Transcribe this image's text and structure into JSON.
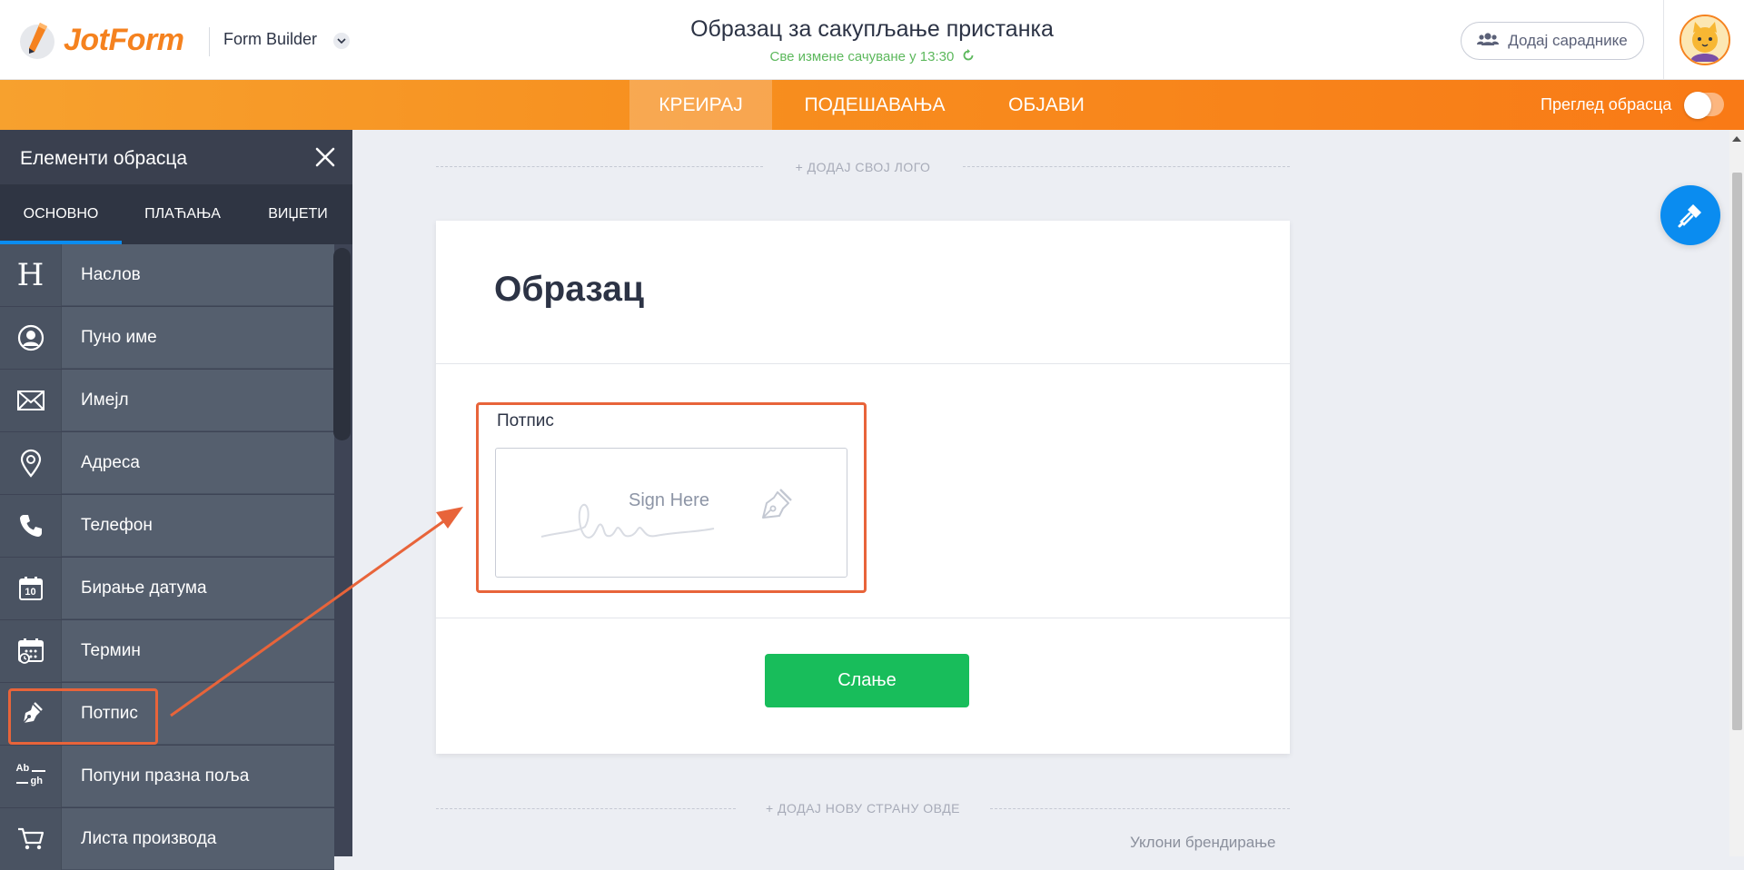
{
  "header": {
    "brand": "JotForm",
    "builder_label": "Form Builder",
    "form_title": "Образац за сакупљање пристанка",
    "save_status": "Све измене сачуване у 13:30",
    "collab_button": "Додај сараднике"
  },
  "nav": {
    "tabs": [
      {
        "label": "КРЕИРАЈ",
        "active": true
      },
      {
        "label": "ПОДЕШАВАЊА",
        "active": false
      },
      {
        "label": "ОБЈАВИ",
        "active": false
      }
    ],
    "preview_label": "Преглед обрасца"
  },
  "panel": {
    "title": "Елементи обрасца",
    "tabs": [
      {
        "label": "ОСНОВНО",
        "active": true
      },
      {
        "label": "ПЛАЋАЊА",
        "active": false
      },
      {
        "label": "ВИЏЕТИ",
        "active": false
      }
    ],
    "elements": [
      {
        "label": "Наслов",
        "icon": "heading-icon"
      },
      {
        "label": "Пуно име",
        "icon": "user-circle-icon"
      },
      {
        "label": "Имејл",
        "icon": "envelope-icon"
      },
      {
        "label": "Адреса",
        "icon": "map-pin-icon"
      },
      {
        "label": "Телефон",
        "icon": "phone-icon"
      },
      {
        "label": "Бирање датума",
        "icon": "calendar-icon"
      },
      {
        "label": "Термин",
        "icon": "appointment-icon"
      },
      {
        "label": "Потпис",
        "icon": "pen-nib-icon"
      },
      {
        "label": "Попуни празна поља",
        "icon": "fill-blank-icon"
      },
      {
        "label": "Листа производа",
        "icon": "cart-icon"
      }
    ],
    "heading_icon_glyph": "H",
    "calendar_day": "10",
    "fill_blank_top": "Ab",
    "fill_blank_bottom": "gh"
  },
  "canvas": {
    "add_logo": "+ ДОДАЈ СВОЈ ЛОГО",
    "form_heading": "Образац",
    "signature_label": "Потпис",
    "signature_placeholder": "Sign Here",
    "submit_label": "Слање",
    "add_page": "+ ДОДАЈ НОВУ СТРАНУ ОВДЕ",
    "remove_branding": "Уклони брендирање"
  },
  "colors": {
    "brand_orange": "#f5821f",
    "annotation": "#e8643a",
    "submit_green": "#18bd5b",
    "accent_blue": "#0a8cf0"
  }
}
